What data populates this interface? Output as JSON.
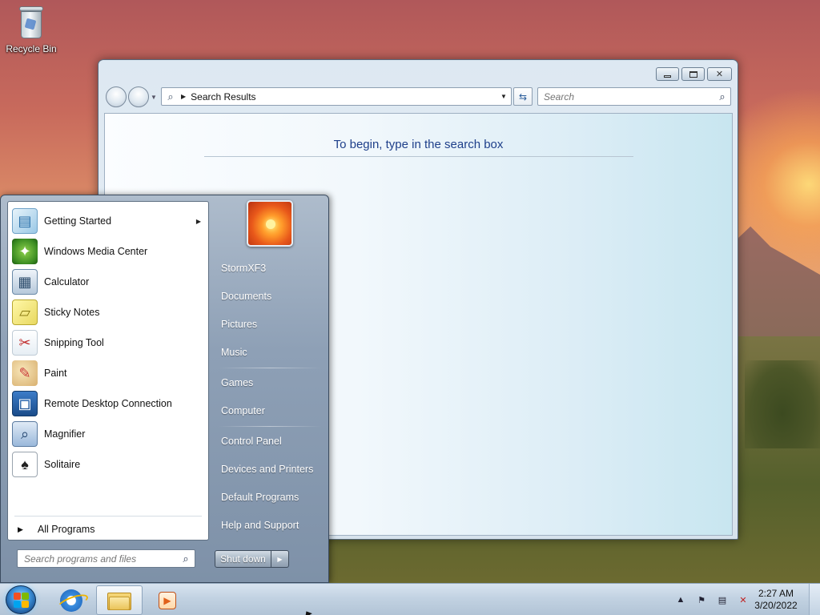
{
  "desktop": {
    "icons": [
      {
        "label": "Recycle Bin"
      }
    ]
  },
  "explorer": {
    "address_path": "Search Results",
    "search_placeholder": "Search",
    "hint_text": "To begin, type in the search box"
  },
  "start_menu": {
    "programs": [
      {
        "label": "Getting Started",
        "icon": "getting-started-icon",
        "has_submenu": true
      },
      {
        "label": "Windows Media Center",
        "icon": "windows-media-center-icon",
        "has_submenu": false
      },
      {
        "label": "Calculator",
        "icon": "calculator-icon",
        "has_submenu": false
      },
      {
        "label": "Sticky Notes",
        "icon": "sticky-notes-icon",
        "has_submenu": false
      },
      {
        "label": "Snipping Tool",
        "icon": "snipping-tool-icon",
        "has_submenu": false
      },
      {
        "label": "Paint",
        "icon": "paint-icon",
        "has_submenu": false
      },
      {
        "label": "Remote Desktop Connection",
        "icon": "remote-desktop-icon",
        "has_submenu": false
      },
      {
        "label": "Magnifier",
        "icon": "magnifier-icon",
        "has_submenu": false
      },
      {
        "label": "Solitaire",
        "icon": "solitaire-icon",
        "has_submenu": false
      }
    ],
    "all_programs_label": "All Programs",
    "search_placeholder": "Search programs and files",
    "right_items": {
      "user": "StormXF3",
      "documents": "Documents",
      "pictures": "Pictures",
      "music": "Music",
      "games": "Games",
      "computer": "Computer",
      "control_panel": "Control Panel",
      "devices_printers": "Devices and Printers",
      "default_programs": "Default Programs",
      "help_support": "Help and Support"
    },
    "shutdown_label": "Shut down"
  },
  "taskbar": {
    "pinned": [
      {
        "icon": "internet-explorer-icon"
      },
      {
        "icon": "windows-explorer-icon",
        "active": true
      },
      {
        "icon": "windows-media-player-icon"
      }
    ],
    "tray_icons": [
      "show-hidden-icons-icon",
      "action-center-flag-icon",
      "network-icon",
      "volume-muted-icon"
    ],
    "clock": {
      "time": "2:27 AM",
      "date": "3/20/2022"
    }
  }
}
